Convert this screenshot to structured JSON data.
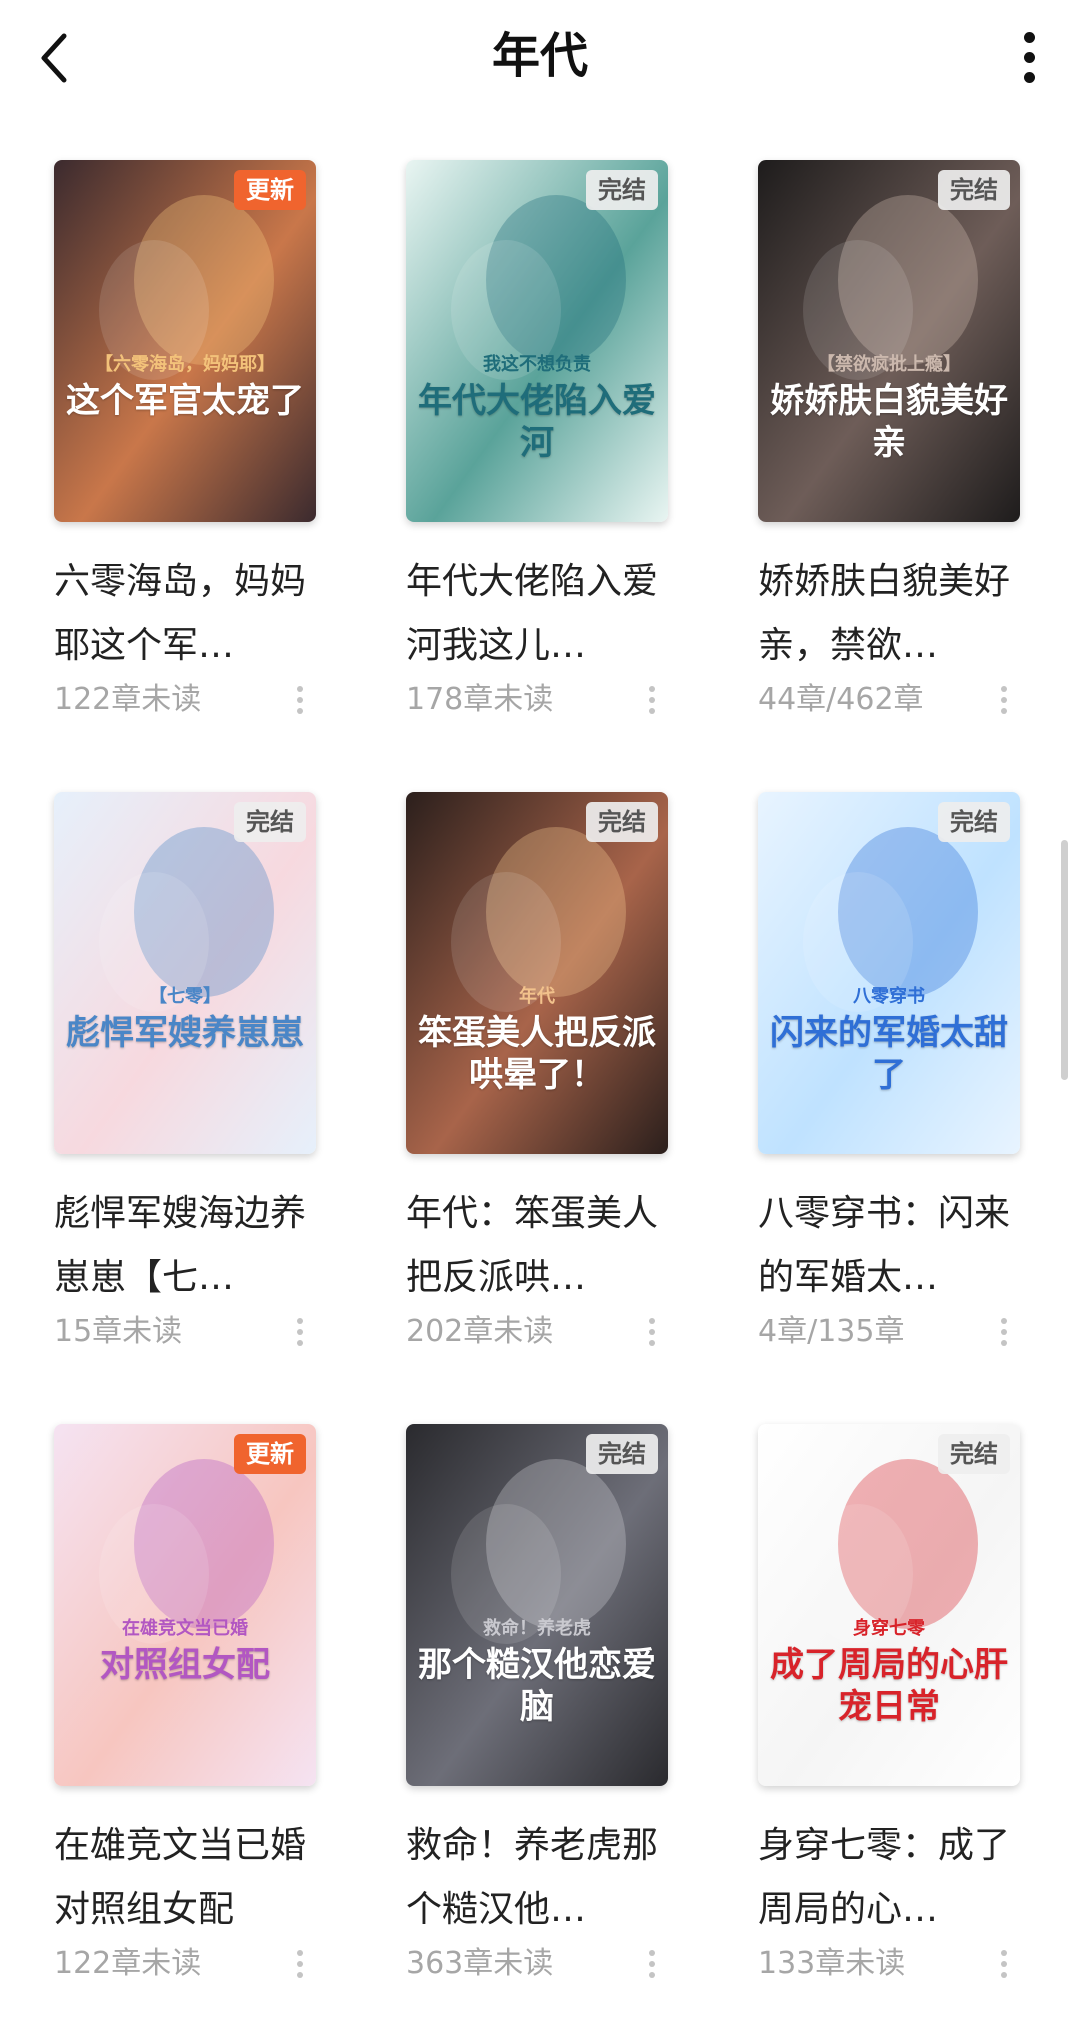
{
  "header": {
    "title": "年代"
  },
  "books": [
    {
      "title": "六零海岛，妈妈耶这个军…",
      "meta": "122章未读",
      "badge": "更新",
      "badge_type": "update",
      "cover_text": "这个军官太宠了",
      "cover_sub": "【六零海岛，妈妈耶】",
      "palette": [
        "#3b2a2e",
        "#c9774a",
        "#f3c27a"
      ]
    },
    {
      "title": "年代大佬陷入爱河我这儿…",
      "meta": "178章未读",
      "badge": "完结",
      "badge_type": "done",
      "cover_text": "年代大佬陷入爱河",
      "cover_sub": "我这不想负责",
      "palette": [
        "#e9f5f2",
        "#5aa39a",
        "#1f6d7a"
      ]
    },
    {
      "title": "娇娇肤白貌美好亲，禁欲…",
      "meta": "44章/462章",
      "badge": "完结",
      "badge_type": "done",
      "cover_text": "娇娇肤白貌美好亲",
      "cover_sub": "【禁欲疯批上瘾】",
      "palette": [
        "#1e1c1c",
        "#6e5d58",
        "#cbb8ad"
      ]
    },
    {
      "title": "彪悍军嫂海边养崽崽【七…",
      "meta": "15章未读",
      "badge": "完结",
      "badge_type": "done",
      "cover_text": "彪悍军嫂养崽崽",
      "cover_sub": "【七零】",
      "palette": [
        "#e6f0fb",
        "#f7d9df",
        "#4a86c7"
      ]
    },
    {
      "title": "年代：笨蛋美人把反派哄…",
      "meta": "202章未读",
      "badge": "完结",
      "badge_type": "done",
      "cover_text": "笨蛋美人把反派哄晕了！",
      "cover_sub": "年代",
      "palette": [
        "#2b1f1c",
        "#a8644a",
        "#f2c28c"
      ]
    },
    {
      "title": "八零穿书：闪来的军婚太…",
      "meta": "4章/135章",
      "badge": "完结",
      "badge_type": "done",
      "cover_text": "闪来的军婚太甜了",
      "cover_sub": "八零穿书",
      "palette": [
        "#e8f4ff",
        "#bfe2ff",
        "#2f6fd6"
      ]
    },
    {
      "title": "在雄竞文当已婚对照组女配",
      "meta": "122章未读",
      "badge": "更新",
      "badge_type": "update",
      "cover_text": "对照组女配",
      "cover_sub": "在雄竞文当已婚",
      "palette": [
        "#f5e3f2",
        "#f7c6c0",
        "#b257c2"
      ]
    },
    {
      "title": "救命！养老虎那个糙汉他…",
      "meta": "363章未读",
      "badge": "完结",
      "badge_type": "done",
      "cover_text": "那个糙汉他恋爱脑",
      "cover_sub": "救命！养老虎",
      "palette": [
        "#2a2a2e",
        "#6d6e78",
        "#c9c9cf"
      ]
    },
    {
      "title": "身穿七零：成了周局的心…",
      "meta": "133章未读",
      "badge": "完结",
      "badge_type": "done",
      "cover_text": "成了周局的心肝宠日常",
      "cover_sub": "身穿七零",
      "palette": [
        "#ffffff",
        "#f5f5f5",
        "#d8232a"
      ]
    }
  ],
  "colors": {
    "update_badge": "#f0642e",
    "meta_text": "#a6a6a6",
    "title_text": "#222222"
  }
}
